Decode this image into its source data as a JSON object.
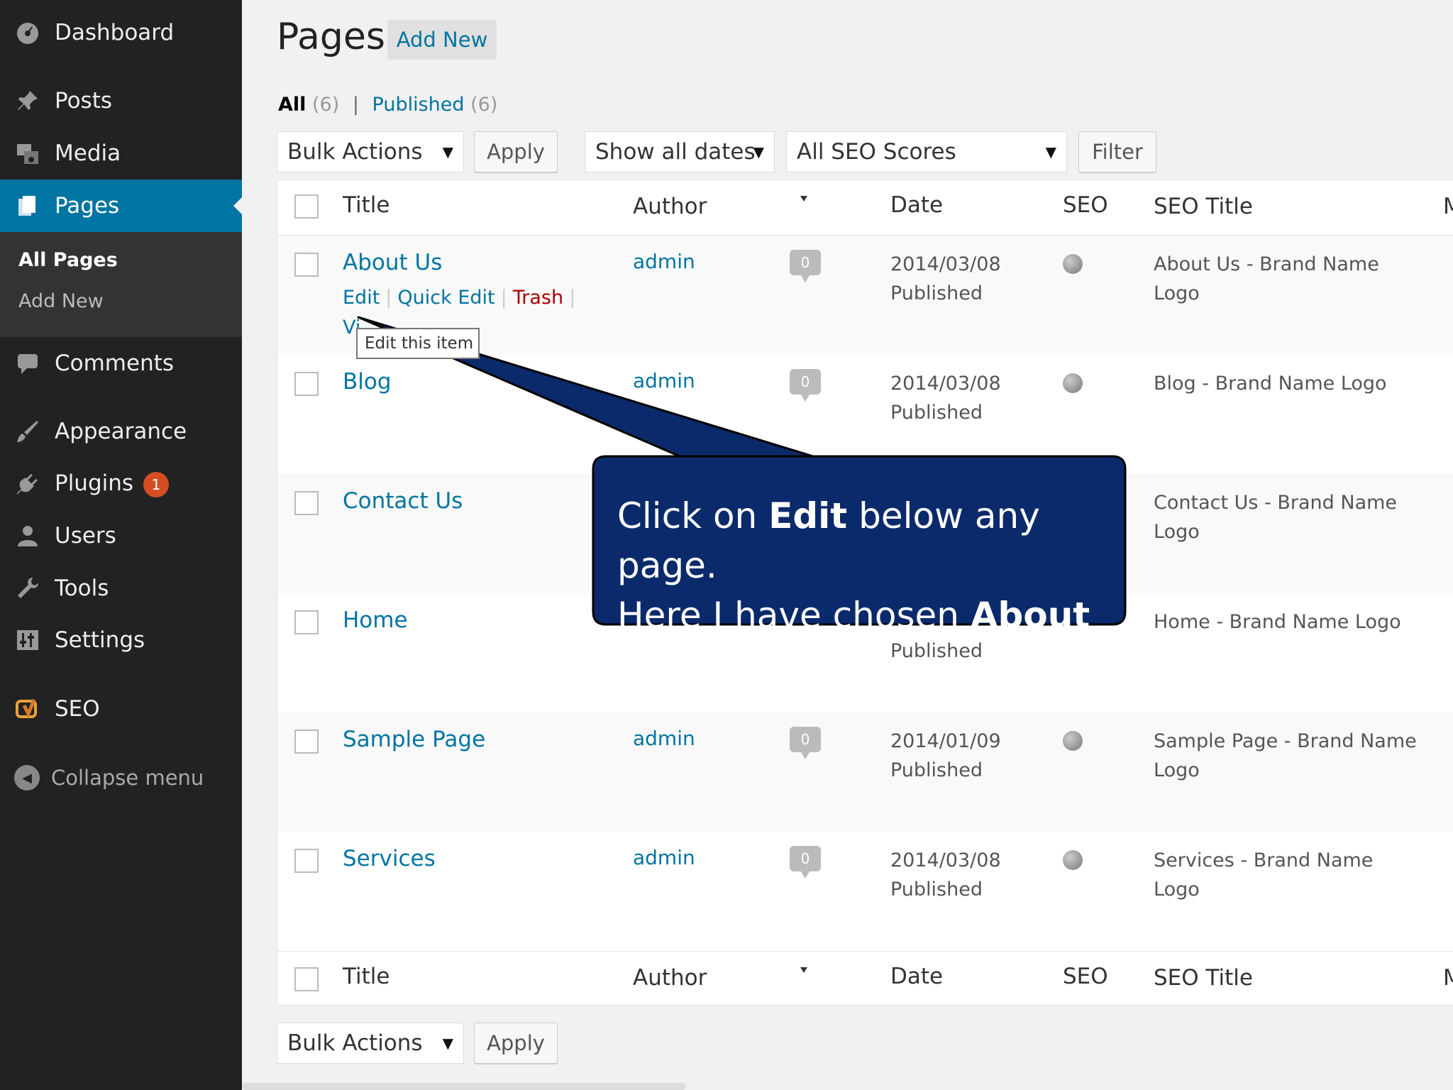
{
  "sidebar": {
    "dashboard": "Dashboard",
    "posts": "Posts",
    "media": "Media",
    "pages": "Pages",
    "sub_all_pages": "All Pages",
    "sub_add_new": "Add New",
    "comments": "Comments",
    "appearance": "Appearance",
    "plugins": "Plugins",
    "plugins_badge": "1",
    "users": "Users",
    "tools": "Tools",
    "settings": "Settings",
    "seo": "SEO",
    "collapse": "Collapse menu"
  },
  "header": {
    "title": "Pages",
    "add_new": "Add New"
  },
  "filters": {
    "all_label": "All",
    "all_count": "(6)",
    "published_label": "Published",
    "published_count": "(6)",
    "separator": "|"
  },
  "toolbar": {
    "bulk_actions": "Bulk Actions",
    "apply": "Apply",
    "dates": "Show all dates",
    "seo_scores": "All SEO Scores",
    "filter": "Filter"
  },
  "table": {
    "columns": {
      "title": "Title",
      "author": "Author",
      "date": "Date",
      "seo": "SEO",
      "seo_title": "SEO Title",
      "more": "M"
    },
    "rows": [
      {
        "title": "About Us",
        "author": "admin",
        "comments": "0",
        "date": "2014/03/08",
        "status": "Published",
        "seo_title": "About Us - Brand Name Logo"
      },
      {
        "title": "Blog",
        "author": "admin",
        "comments": "0",
        "date": "2014/03/08",
        "status": "Published",
        "seo_title": "Blog - Brand Name Logo"
      },
      {
        "title": "Contact Us",
        "author": "",
        "comments": "",
        "date": "",
        "status": "",
        "seo_title": "Contact Us - Brand Name Logo"
      },
      {
        "title": "Home",
        "author": "",
        "comments": "",
        "date": "",
        "status": "Published",
        "seo_title": "Home - Brand Name Logo"
      },
      {
        "title": "Sample Page",
        "author": "admin",
        "comments": "0",
        "date": "2014/01/09",
        "status": "Published",
        "seo_title": "Sample Page - Brand Name Logo"
      },
      {
        "title": "Services",
        "author": "admin",
        "comments": "0",
        "date": "2014/03/08",
        "status": "Published",
        "seo_title": "Services - Brand Name Logo"
      }
    ],
    "row_actions": {
      "edit": "Edit",
      "quick_edit": "Quick Edit",
      "trash": "Trash",
      "view": "Vi",
      "sep": "|"
    },
    "tooltip": "Edit this item"
  },
  "callout": {
    "line1_pre": "Click on ",
    "line1_bold": "Edit",
    "line1_post": " below any page.",
    "line2_pre": "Here I have chosen ",
    "line2_bold": "About Us",
    "line2_post": "."
  },
  "colors": {
    "sidebar_bg": "#222222",
    "active": "#0074a2",
    "link": "#0074a2",
    "callout_bg": "#0b2a6b",
    "trash": "#aa0000",
    "badge": "#d54e21"
  }
}
